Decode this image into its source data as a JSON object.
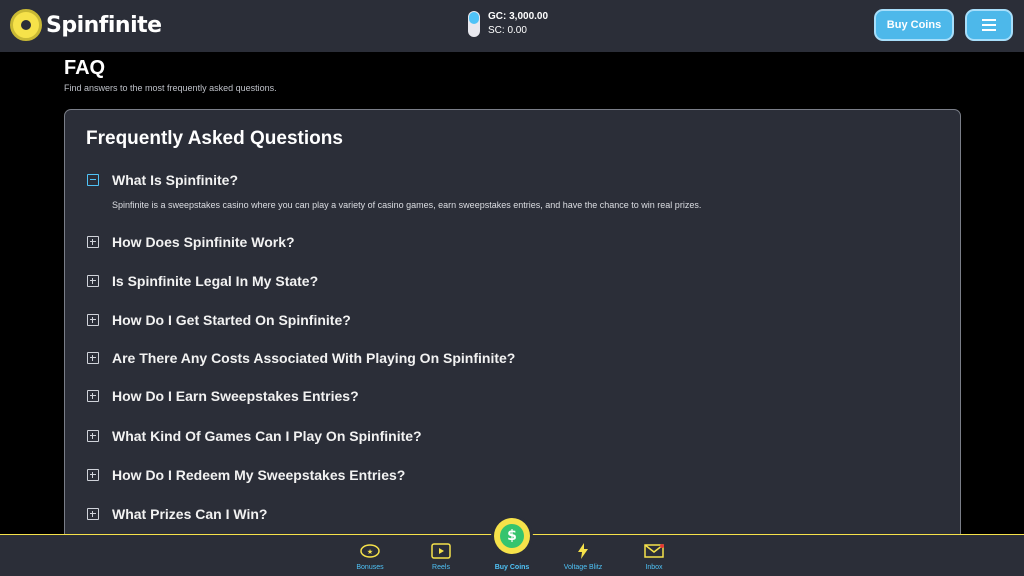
{
  "header": {
    "brand": "Spinfinite",
    "balance_gc": "GC: 3,000.00",
    "balance_sc": "SC: 0.00",
    "buy_coins_label": "Buy Coins"
  },
  "page": {
    "title": "FAQ",
    "subtitle": "Find answers to the most frequently asked questions."
  },
  "faq": {
    "heading": "Frequently Asked Questions",
    "items": [
      {
        "question": "What Is Spinfinite?",
        "expanded": true,
        "answer": "Spinfinite is a sweepstakes casino where you can play a variety of casino games, earn sweepstakes entries, and have the chance to win real prizes."
      },
      {
        "question": "How Does Spinfinite Work?",
        "expanded": false
      },
      {
        "question": "Is Spinfinite Legal In My State?",
        "expanded": false
      },
      {
        "question": "How Do I Get Started On Spinfinite?",
        "expanded": false
      },
      {
        "question": "Are There Any Costs Associated With Playing On Spinfinite?",
        "expanded": false
      },
      {
        "question": "How Do I Earn Sweepstakes Entries?",
        "expanded": false
      },
      {
        "question": "What Kind Of Games Can I Play On Spinfinite?",
        "expanded": false
      },
      {
        "question": "How Do I Redeem My Sweepstakes Entries?",
        "expanded": false
      },
      {
        "question": "What Prizes Can I Win?",
        "expanded": false
      }
    ]
  },
  "bottom_nav": {
    "items": [
      {
        "label": "Bonuses",
        "icon": "bonus-badge-icon"
      },
      {
        "label": "Reels",
        "icon": "play-reel-icon"
      },
      {
        "label": "Buy Coins",
        "icon": "dollar-coin-icon",
        "active": true
      },
      {
        "label": "Voltage Blitz",
        "icon": "lightning-icon"
      },
      {
        "label": "Inbox",
        "icon": "envelope-icon"
      }
    ]
  },
  "colors": {
    "accent": "#4fc3f7",
    "highlight": "#f6e24a",
    "surface": "#2b2e38",
    "background": "#000000"
  }
}
